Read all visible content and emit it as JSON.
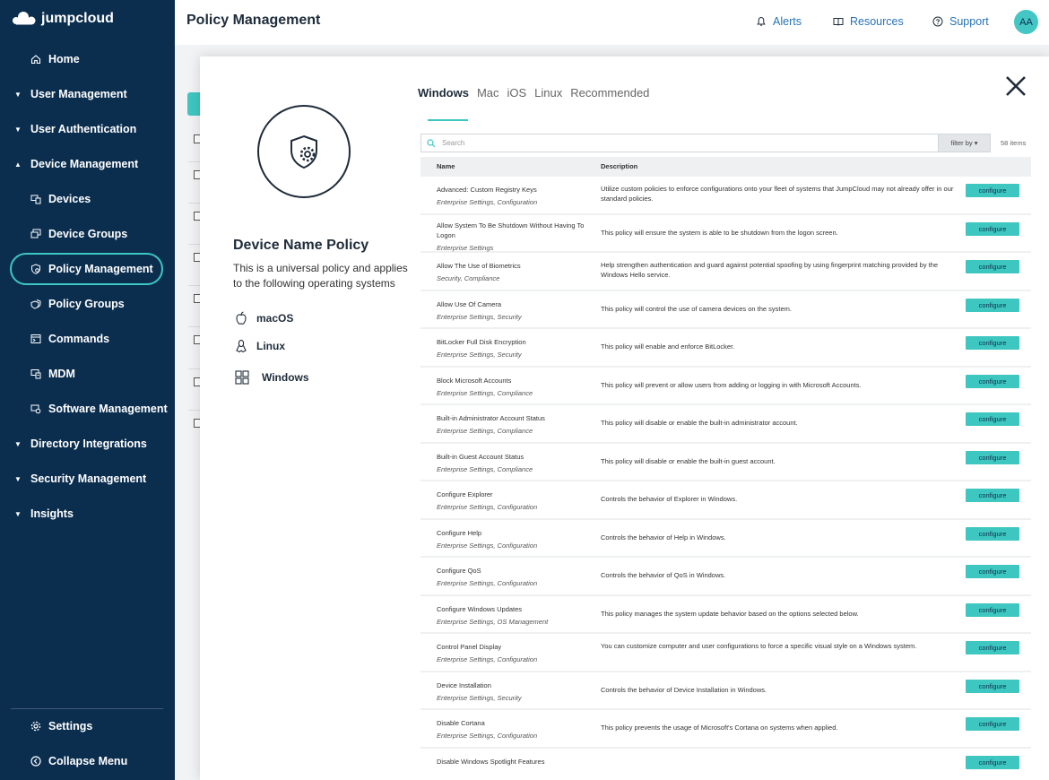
{
  "sidebar": {
    "brand": "jumpcloud",
    "items": [
      {
        "label": "Home",
        "icon": "home-icon",
        "caret": ""
      },
      {
        "label": "User Management",
        "icon": "",
        "caret": "▼"
      },
      {
        "label": "User Authentication",
        "icon": "",
        "caret": "▼"
      },
      {
        "label": "Device Management",
        "icon": "",
        "caret": "▲"
      },
      {
        "label": "Devices",
        "icon": "devices-icon",
        "caret": ""
      },
      {
        "label": "Device Groups",
        "icon": "device-groups-icon",
        "caret": ""
      },
      {
        "label": "Policy Management",
        "icon": "policy-icon",
        "caret": ""
      },
      {
        "label": "Policy Groups",
        "icon": "policy-groups-icon",
        "caret": ""
      },
      {
        "label": "Commands",
        "icon": "commands-icon",
        "caret": ""
      },
      {
        "label": "MDM",
        "icon": "mdm-icon",
        "caret": ""
      },
      {
        "label": "Software Management",
        "icon": "software-icon",
        "caret": ""
      },
      {
        "label": "Directory Integrations",
        "icon": "",
        "caret": "▼"
      },
      {
        "label": "Security Management",
        "icon": "",
        "caret": "▼"
      },
      {
        "label": "Insights",
        "icon": "",
        "caret": "▼"
      }
    ],
    "settings": "Settings",
    "collapse": "Collapse Menu"
  },
  "header": {
    "title": "Policy Management",
    "alerts": "Alerts",
    "resources": "Resources",
    "support": "Support",
    "avatar": "AA"
  },
  "modal": {
    "policy_title": "Device Name Policy",
    "policy_desc": "This is a universal policy and applies to the following operating systems",
    "os": [
      "macOS",
      "Linux",
      "Windows"
    ],
    "tabs": [
      "Windows",
      "Mac",
      "iOS",
      "Linux",
      "Recommended"
    ],
    "active_tab": "Windows",
    "search_placeholder": "Search",
    "filter_label": "filter by ▾",
    "item_count": "58 items",
    "col_name": "Name",
    "col_desc": "Description",
    "configure_label": "configure",
    "rows": [
      {
        "name": "Advanced: Custom Registry Keys",
        "cat": "Enterprise Settings, Configuration",
        "desc": "Utilize custom policies to enforce configurations onto your fleet of systems that JumpCloud may not already offer in our standard policies."
      },
      {
        "name": "Allow System To Be Shutdown Without Having To Logon",
        "cat": "Enterprise Settings",
        "desc": "This policy will ensure the system is able to be shutdown from the logon screen."
      },
      {
        "name": "Allow The Use of Biometrics",
        "cat": "Security, Compliance",
        "desc": "Help strengthen authentication and guard against potential spoofing by using fingerprint matching provided by the Windows Hello service."
      },
      {
        "name": "Allow Use Of Camera",
        "cat": "Enterprise Settings, Security",
        "desc": "This policy will control the use of camera devices on the system."
      },
      {
        "name": "BitLocker Full Disk Encryption",
        "cat": "Enterprise Settings, Security",
        "desc": "This policy will enable and enforce BitLocker."
      },
      {
        "name": "Block Microsoft Accounts",
        "cat": "Enterprise Settings, Compliance",
        "desc": "This policy will prevent or allow users from adding or logging in with Microsoft Accounts."
      },
      {
        "name": "Built-in Administrator Account Status",
        "cat": "Enterprise Settings, Compliance",
        "desc": "This policy will disable or enable the built-in administrator account."
      },
      {
        "name": "Built-in Guest Account Status",
        "cat": "Enterprise Settings, Compliance",
        "desc": "This policy will disable or enable the built-in guest account."
      },
      {
        "name": "Configure Explorer",
        "cat": "Enterprise Settings, Configuration",
        "desc": "Controls the behavior of Explorer in Windows."
      },
      {
        "name": "Configure Help",
        "cat": "Enterprise Settings, Configuration",
        "desc": "Controls the behavior of Help in Windows."
      },
      {
        "name": "Configure QoS",
        "cat": "Enterprise Settings, Configuration",
        "desc": "Controls the behavior of QoS in Windows."
      },
      {
        "name": "Configure Windows Updates",
        "cat": "Enterprise Settings, OS Management",
        "desc": "This policy manages the system update behavior based on the options selected below."
      },
      {
        "name": "Control Panel Display",
        "cat": "Enterprise Settings, Configuration",
        "desc": "You can customize computer and user configurations to force a specific visual style on a Windows system."
      },
      {
        "name": "Device Installation",
        "cat": "Enterprise Settings, Security",
        "desc": "Controls the behavior of Device Installation in Windows."
      },
      {
        "name": "Disable Cortana",
        "cat": "Enterprise Settings, Configuration",
        "desc": "This policy prevents the usage of Microsoft's Cortana on systems when applied."
      },
      {
        "name": "Disable Windows Spotlight Features",
        "cat": "",
        "desc": ""
      }
    ]
  },
  "colors": {
    "sidebar_bg": "#0b2e4f",
    "accent": "#3ec7c1",
    "link": "#2773b7"
  }
}
